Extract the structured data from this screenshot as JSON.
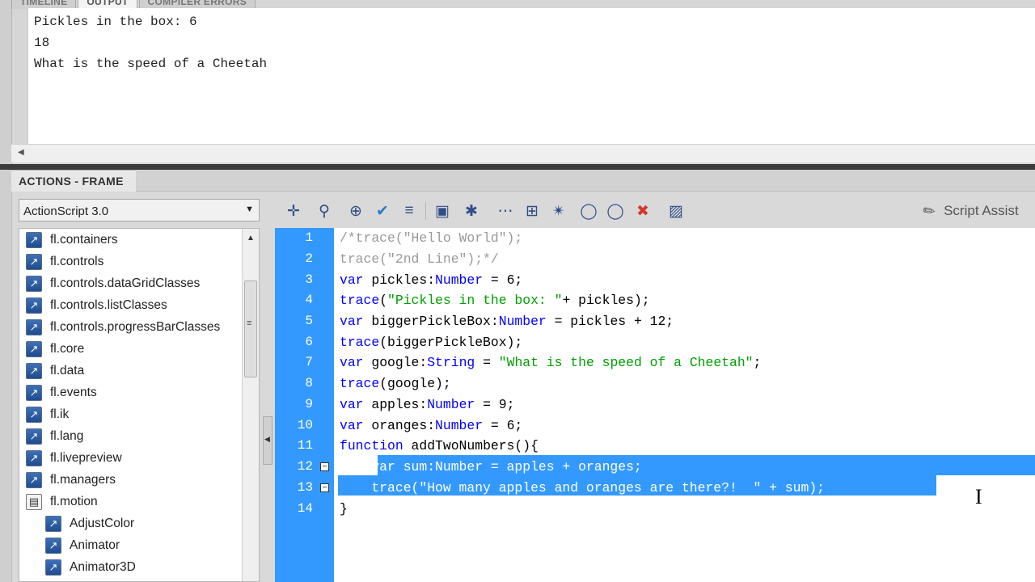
{
  "output": {
    "tabs": [
      "TIMELINE",
      "OUTPUT",
      "COMPILER ERRORS"
    ],
    "lines": [
      "Pickles in the box: 6",
      "18",
      "What is the speed of a Cheetah"
    ]
  },
  "actions": {
    "title": "ACTIONS - FRAME",
    "language": "ActionScript 3.0",
    "tree_items": [
      {
        "label": "fl.containers",
        "icon": "package-icon"
      },
      {
        "label": "fl.controls",
        "icon": "package-icon"
      },
      {
        "label": "fl.controls.dataGridClasses",
        "icon": "package-icon"
      },
      {
        "label": "fl.controls.listClasses",
        "icon": "package-icon"
      },
      {
        "label": "fl.controls.progressBarClasses",
        "icon": "package-icon"
      },
      {
        "label": "fl.core",
        "icon": "package-icon"
      },
      {
        "label": "fl.data",
        "icon": "package-icon"
      },
      {
        "label": "fl.events",
        "icon": "package-icon"
      },
      {
        "label": "fl.ik",
        "icon": "package-icon"
      },
      {
        "label": "fl.lang",
        "icon": "package-icon"
      },
      {
        "label": "fl.livepreview",
        "icon": "package-icon"
      },
      {
        "label": "fl.managers",
        "icon": "package-icon"
      },
      {
        "label": "fl.motion",
        "icon": "book-icon"
      },
      {
        "label": "AdjustColor",
        "icon": "class-icon"
      },
      {
        "label": "Animator",
        "icon": "class-icon"
      },
      {
        "label": "Animator3D",
        "icon": "class-icon"
      }
    ],
    "script_assist": "Script Assist"
  },
  "toolbar_icons": [
    "add-statement-icon",
    "find-icon",
    "insert-target-path-icon",
    "check-syntax-icon",
    "auto-format-icon",
    "code-hint-icon",
    "debug-options-icon",
    "collapse-between-braces-icon",
    "collapse-selection-icon",
    "expand-all-icon",
    "apply-block-comment-icon",
    "apply-line-comment-icon",
    "remove-comment-icon",
    "show-hide-toolbox-icon"
  ],
  "code": {
    "line_numbers": [
      "1",
      "2",
      "3",
      "4",
      "5",
      "6",
      "7",
      "8",
      "9",
      "10",
      "11",
      "12",
      "13",
      "14"
    ],
    "l1": "/*trace(\"Hello World\");",
    "l2": "trace(\"2nd Line\");*/",
    "l3a": "var",
    "l3b": " pickles:",
    "l3c": "Number",
    "l3d": " = 6;",
    "l4a": "trace",
    "l4b": "(",
    "l4c": "\"Pickles in the box: \"",
    "l4d": "+ pickles);",
    "l5a": "var",
    "l5b": " biggerPickleBox:",
    "l5c": "Number",
    "l5d": " = pickles + 12;",
    "l6a": "trace",
    "l6b": "(biggerPickleBox);",
    "l7a": "var",
    "l7b": " google:",
    "l7c": "String",
    "l7d": " = ",
    "l7e": "\"What is the speed of a Cheetah\"",
    "l7f": ";",
    "l8a": "trace",
    "l8b": "(google);",
    "l9a": "var",
    "l9b": " apples:",
    "l9c": "Number",
    "l9d": " = 9;",
    "l10a": "var",
    "l10b": " oranges:",
    "l10c": "Number",
    "l10d": " = 6;",
    "l11a": "function",
    "l11b": " addTwoNumbers(){",
    "l12": "    var sum:Number = apples + oranges;",
    "l13": "    trace(\"How many apples and oranges are there?!  \" + sum);",
    "l14": "}"
  }
}
